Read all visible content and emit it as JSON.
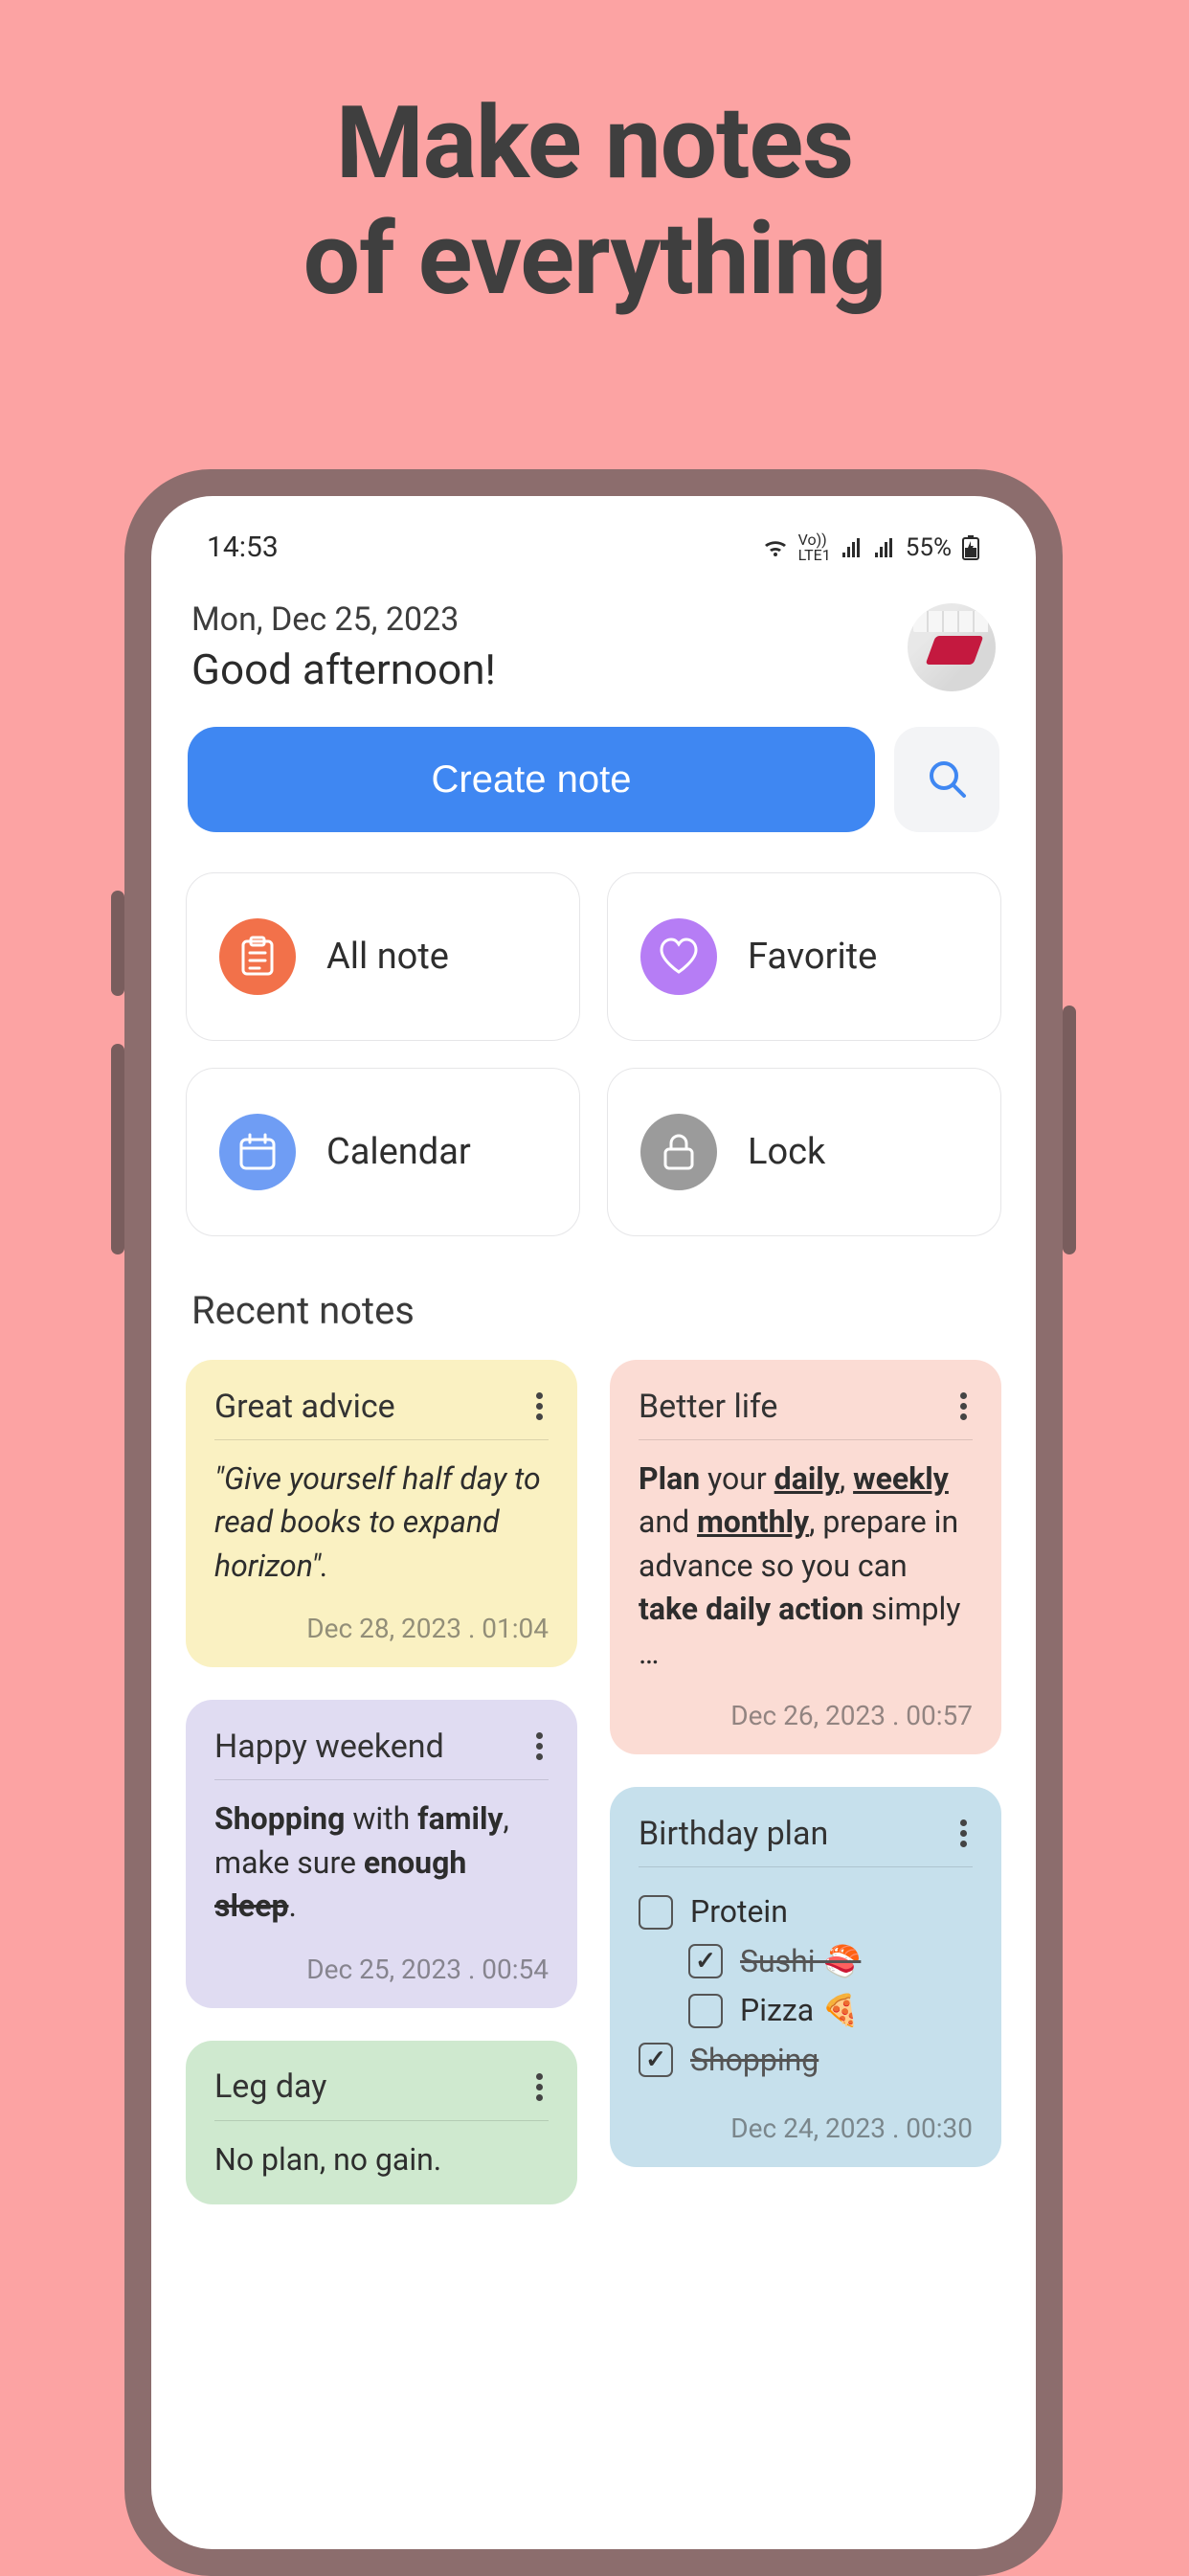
{
  "hero": {
    "line1": "Make notes",
    "line2": "of everything"
  },
  "status": {
    "time": "14:53",
    "net_text": "LTE1",
    "battery": "55%"
  },
  "header": {
    "date": "Mon, Dec 25, 2023",
    "greeting": "Good afternoon!"
  },
  "actions": {
    "create": "Create note"
  },
  "categories": [
    {
      "key": "all",
      "label": "All note",
      "icon": "notes-icon",
      "color": "ci-orange"
    },
    {
      "key": "favorite",
      "label": "Favorite",
      "icon": "heart-icon",
      "color": "ci-purple"
    },
    {
      "key": "calendar",
      "label": "Calendar",
      "icon": "calendar-icon",
      "color": "ci-blue"
    },
    {
      "key": "lock",
      "label": "Lock",
      "icon": "lock-icon",
      "color": "ci-gray"
    }
  ],
  "section_recent": "Recent notes",
  "notes": {
    "great_advice": {
      "title": "Great advice",
      "body_html": "<i>\"Give yourself half day to read books to expand horizon\".</i>",
      "date": "Dec 28, 2023 . 01:04"
    },
    "better_life": {
      "title": "Better life",
      "body_html": "<b>Plan</b> your <u><b>daily</b></u>, <u><b>weekly</b></u> and <u><b>monthly</b></u>, prepare in advance so you can <b>take daily action</b> simply …",
      "date": "Dec 26, 2023 . 00:57"
    },
    "happy_weekend": {
      "title": "Happy weekend",
      "body_html": "<b>Shopping</b> with <b>family</b>, make sure <b>enough <s>sleep</s></b>.",
      "date": "Dec 25, 2023 . 00:54"
    },
    "birthday": {
      "title": "Birthday plan",
      "items": [
        {
          "label": "Protein",
          "checked": false,
          "indent": 0
        },
        {
          "label": "Sushi 🍣",
          "checked": true,
          "indent": 1
        },
        {
          "label": "Pizza 🍕",
          "checked": false,
          "indent": 1
        },
        {
          "label": "Shopping",
          "checked": true,
          "indent": 0
        }
      ],
      "date": "Dec 24, 2023 . 00:30"
    },
    "leg_day": {
      "title": "Leg day",
      "body_text": "No plan, no gain."
    }
  }
}
